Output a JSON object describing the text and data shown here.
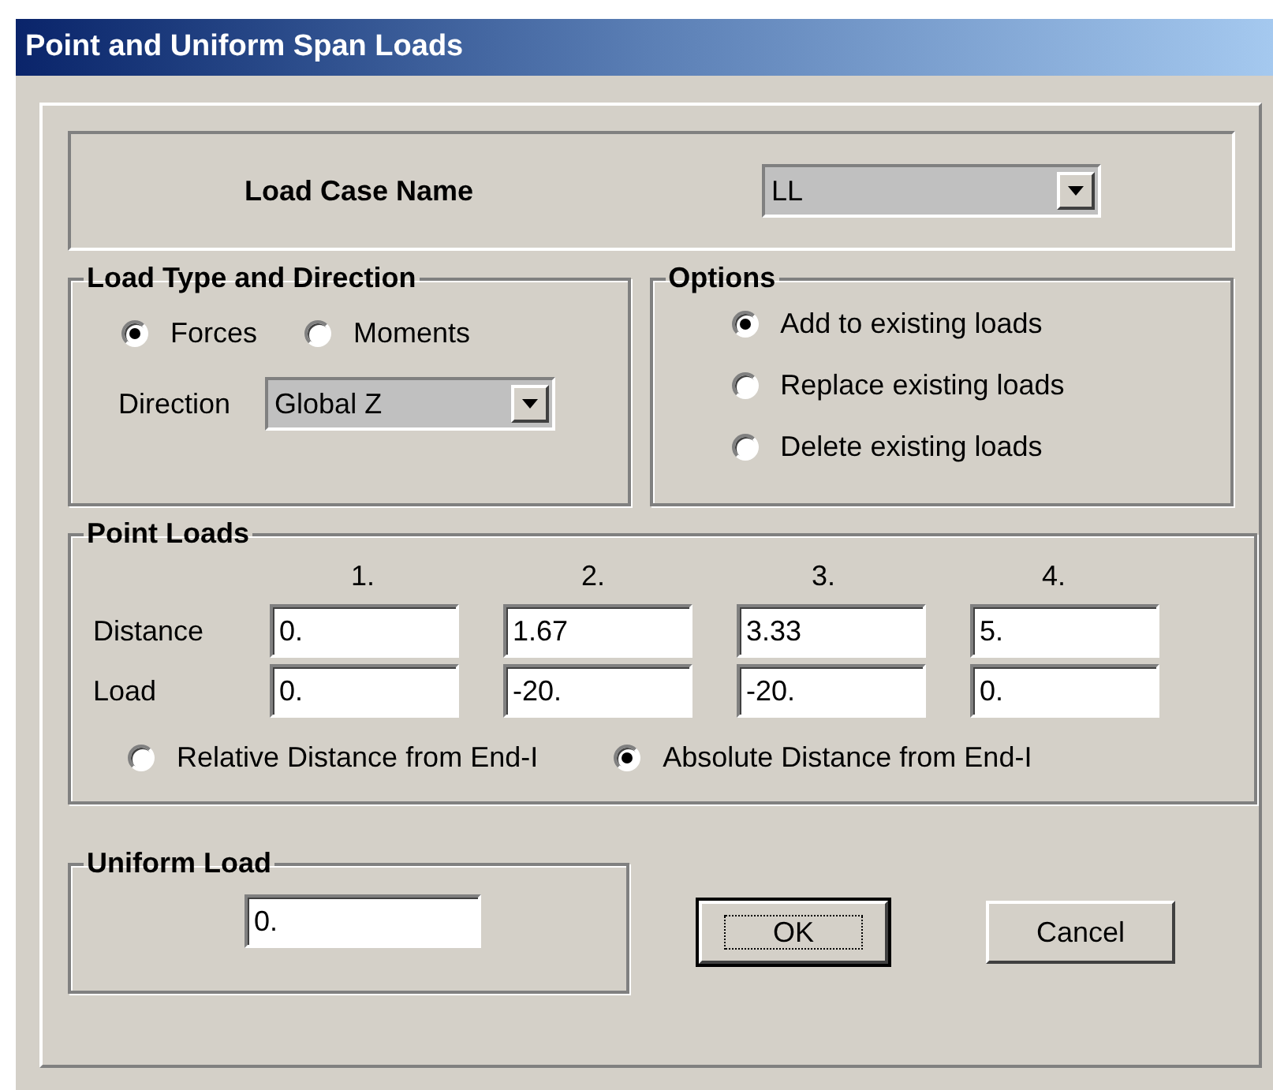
{
  "window": {
    "title": "Point and Uniform Span Loads"
  },
  "load_case": {
    "label": "Load Case Name",
    "value": "LL"
  },
  "load_type": {
    "title": "Load Type and Direction",
    "options": [
      {
        "label": "Forces",
        "selected": true
      },
      {
        "label": "Moments",
        "selected": false
      }
    ],
    "direction_label": "Direction",
    "direction_value": "Global Z"
  },
  "options": {
    "title": "Options",
    "items": [
      {
        "label": "Add to existing loads",
        "selected": true
      },
      {
        "label": "Replace existing loads",
        "selected": false
      },
      {
        "label": "Delete existing loads",
        "selected": false
      }
    ]
  },
  "point_loads": {
    "title": "Point Loads",
    "columns": [
      "1.",
      "2.",
      "3.",
      "4."
    ],
    "rows": [
      {
        "label": "Distance",
        "values": [
          "0.",
          "1.67",
          "3.33",
          "5."
        ]
      },
      {
        "label": "Load",
        "values": [
          "0.",
          "-20.",
          "-20.",
          "0."
        ]
      }
    ],
    "distance_modes": [
      {
        "label": "Relative Distance from End-I",
        "selected": false
      },
      {
        "label": "Absolute Distance from End-I",
        "selected": true
      }
    ]
  },
  "uniform_load": {
    "title": "Uniform Load",
    "value": "0."
  },
  "buttons": [
    {
      "label": "OK",
      "default": true
    },
    {
      "label": "Cancel",
      "default": false
    }
  ]
}
